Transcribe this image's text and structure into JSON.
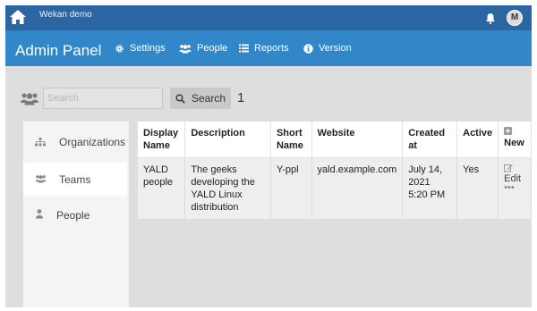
{
  "app": {
    "board_title": "Wekan demo",
    "avatar_initial": "M"
  },
  "header": {
    "title": "Admin Panel",
    "nav": [
      {
        "label": "Settings",
        "icon": "gear-icon"
      },
      {
        "label": "People",
        "icon": "users-icon"
      },
      {
        "label": "Reports",
        "icon": "list-icon"
      },
      {
        "label": "Version",
        "icon": "info-icon"
      }
    ]
  },
  "search": {
    "placeholder": "Search",
    "value": "",
    "button_label": "Search",
    "result_count": "1"
  },
  "sidebar": {
    "items": [
      {
        "label": "Organizations",
        "icon": "sitemap-icon",
        "active": false
      },
      {
        "label": "Teams",
        "icon": "users-icon",
        "active": true
      },
      {
        "label": "People",
        "icon": "user-icon",
        "active": false
      }
    ]
  },
  "table": {
    "columns": [
      "Display Name",
      "Description",
      "Short Name",
      "Website",
      "Created at",
      "Active",
      "New"
    ],
    "new_icon": "plus-square-icon",
    "rows": [
      {
        "display_name": "YALD people",
        "description": "The geeks developing the YALD Linux distribution",
        "short_name": "Y-ppl",
        "website": "yald.example.com",
        "created_at": "July 14, 2021 5:20 PM",
        "active": "Yes",
        "edit_label": "Edit",
        "more": "•••"
      }
    ]
  },
  "colors": {
    "topbar": "#2b66a2",
    "header": "#3287c8",
    "background": "#dedede"
  }
}
